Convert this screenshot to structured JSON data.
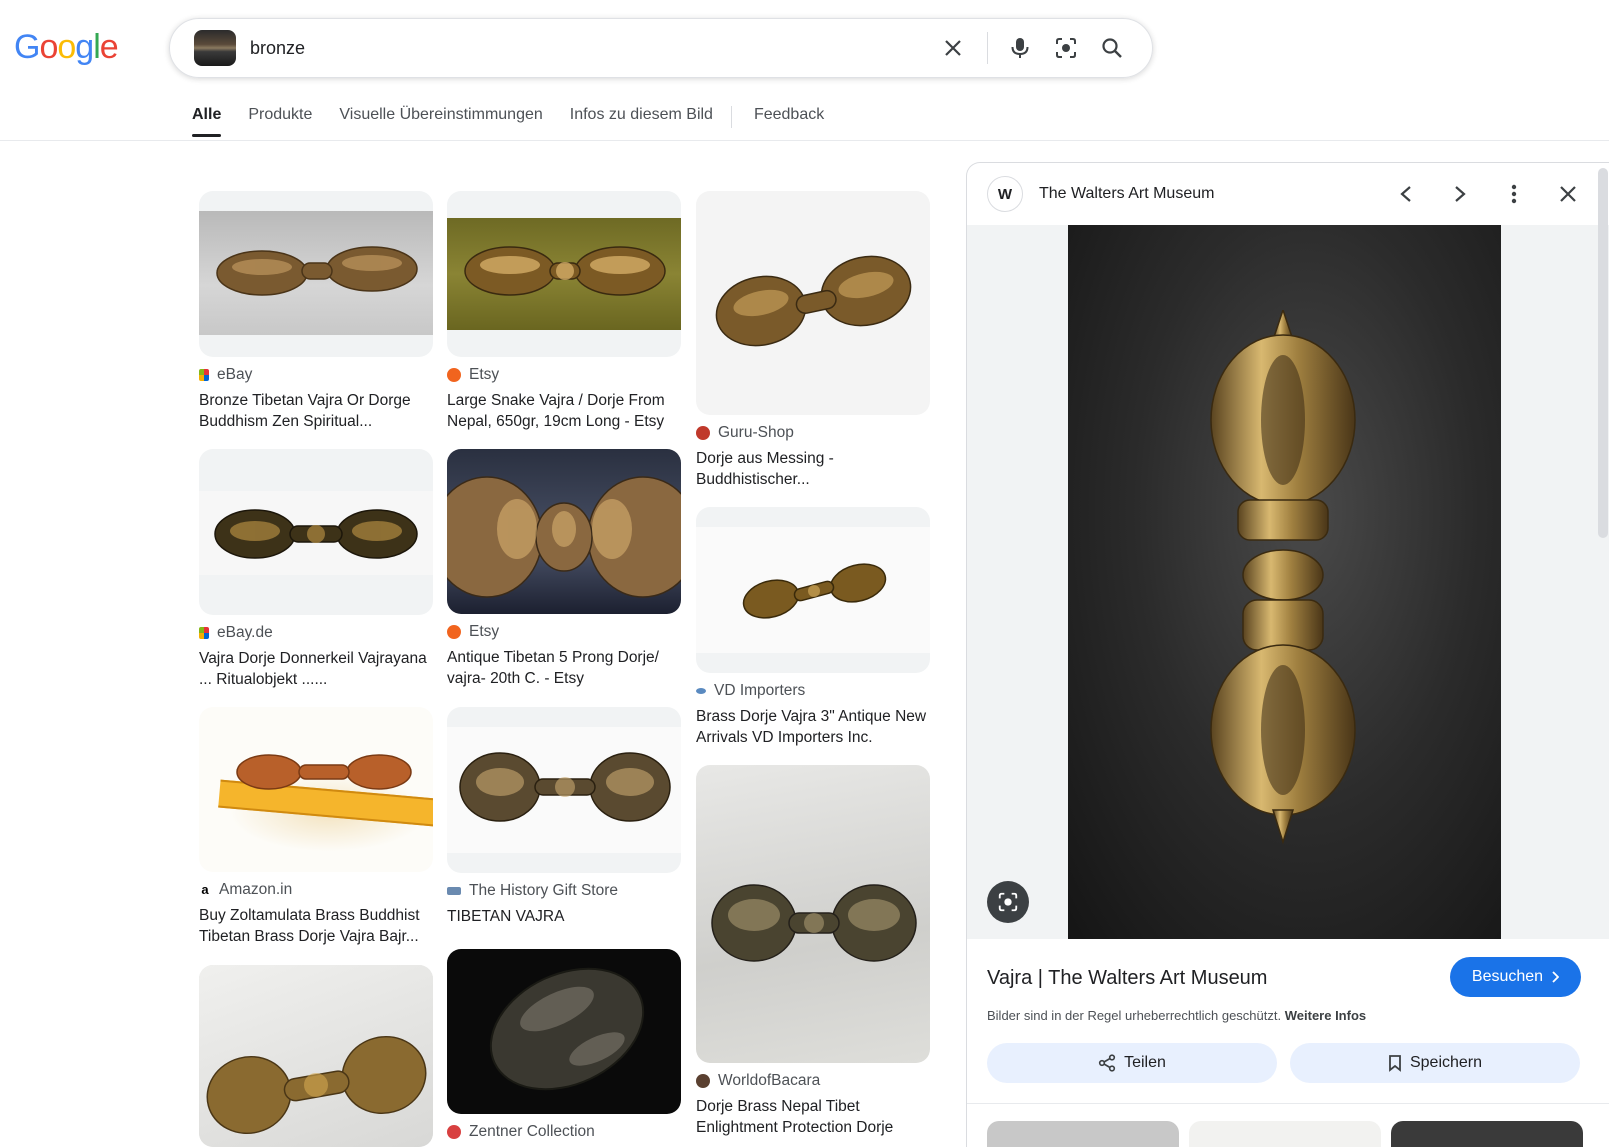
{
  "logo": {
    "letters": [
      "G",
      "o",
      "o",
      "g",
      "l",
      "e"
    ],
    "colors": [
      "#4285F4",
      "#EA4335",
      "#FBBC05",
      "#4285F4",
      "#34A853",
      "#EA4335"
    ]
  },
  "search": {
    "query": "bronze"
  },
  "tabs": [
    "Alle",
    "Produkte",
    "Visuelle Übereinstimmungen",
    "Infos zu diesem Bild",
    "Feedback"
  ],
  "results": [
    {
      "source": "eBay",
      "title": "Bronze Tibetan Vajra Or Dorge Buddhism Zen Spiritual..."
    },
    {
      "source": "Etsy",
      "title": "Large Snake Vajra / Dorje From Nepal, 650gr, 19cm Long - Etsy"
    },
    {
      "source": "Guru-Shop",
      "title": "Dorje aus Messing - Buddhistischer..."
    },
    {
      "source": "eBay.de",
      "title": "Vajra Dorje Donnerkeil Vajrayana ... Ritualobjekt ......"
    },
    {
      "source": "Etsy",
      "title": "Antique Tibetan 5 Prong Dorje/ vajra- 20th C. - Etsy"
    },
    {
      "source": "VD Importers",
      "title": "Brass Dorje Vajra 3\" Antique New Arrivals VD Importers Inc."
    },
    {
      "source": "Amazon.in",
      "title": "Buy Zoltamulata Brass Buddhist Tibetan Brass Dorje Vajra Bajr..."
    },
    {
      "source": "The History Gift Store",
      "title": "TIBETAN VAJRA"
    },
    {
      "source": "WorldofBacara",
      "title": "Dorje Brass Nepal Tibet Enlightment Protection Dorje"
    },
    {
      "source": "Zentner Collection",
      "title": ""
    }
  ],
  "panel": {
    "site_initial": "W",
    "site_name": "The Walters Art Museum",
    "title": "Vajra | The Walters Art Museum",
    "visit_label": "Besuchen",
    "copyright_text": "Bilder sind in der Regel urheberrechtlich geschützt.",
    "more_info": "Weitere Infos",
    "share_label": "Teilen",
    "save_label": "Speichern"
  },
  "colors": {
    "accent": "#1a73e8",
    "chip": "#e8f0fe"
  }
}
